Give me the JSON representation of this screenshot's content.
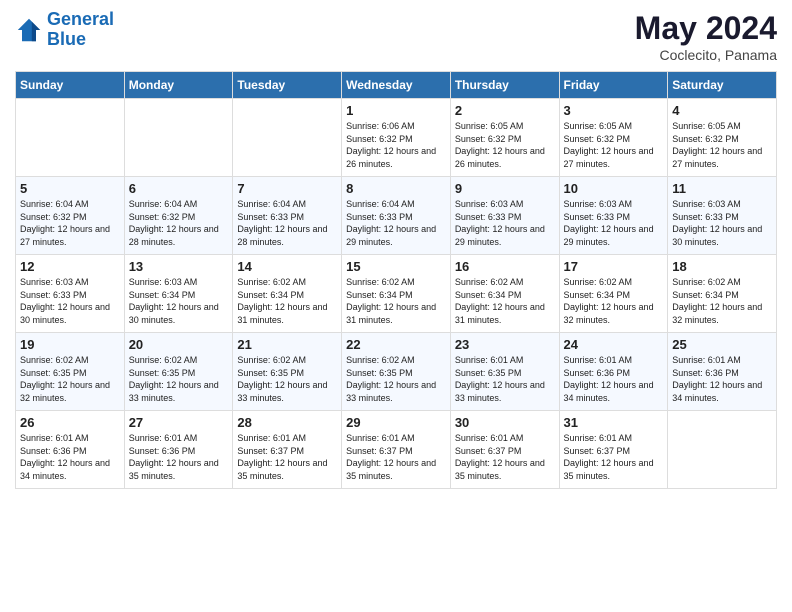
{
  "header": {
    "logo_line1": "General",
    "logo_line2": "Blue",
    "title": "May 2024",
    "subtitle": "Coclecito, Panama"
  },
  "days_of_week": [
    "Sunday",
    "Monday",
    "Tuesday",
    "Wednesday",
    "Thursday",
    "Friday",
    "Saturday"
  ],
  "weeks": [
    [
      {
        "day": "",
        "info": ""
      },
      {
        "day": "",
        "info": ""
      },
      {
        "day": "",
        "info": ""
      },
      {
        "day": "1",
        "info": "Sunrise: 6:06 AM\nSunset: 6:32 PM\nDaylight: 12 hours\nand 26 minutes."
      },
      {
        "day": "2",
        "info": "Sunrise: 6:05 AM\nSunset: 6:32 PM\nDaylight: 12 hours\nand 26 minutes."
      },
      {
        "day": "3",
        "info": "Sunrise: 6:05 AM\nSunset: 6:32 PM\nDaylight: 12 hours\nand 27 minutes."
      },
      {
        "day": "4",
        "info": "Sunrise: 6:05 AM\nSunset: 6:32 PM\nDaylight: 12 hours\nand 27 minutes."
      }
    ],
    [
      {
        "day": "5",
        "info": "Sunrise: 6:04 AM\nSunset: 6:32 PM\nDaylight: 12 hours\nand 27 minutes."
      },
      {
        "day": "6",
        "info": "Sunrise: 6:04 AM\nSunset: 6:32 PM\nDaylight: 12 hours\nand 28 minutes."
      },
      {
        "day": "7",
        "info": "Sunrise: 6:04 AM\nSunset: 6:33 PM\nDaylight: 12 hours\nand 28 minutes."
      },
      {
        "day": "8",
        "info": "Sunrise: 6:04 AM\nSunset: 6:33 PM\nDaylight: 12 hours\nand 29 minutes."
      },
      {
        "day": "9",
        "info": "Sunrise: 6:03 AM\nSunset: 6:33 PM\nDaylight: 12 hours\nand 29 minutes."
      },
      {
        "day": "10",
        "info": "Sunrise: 6:03 AM\nSunset: 6:33 PM\nDaylight: 12 hours\nand 29 minutes."
      },
      {
        "day": "11",
        "info": "Sunrise: 6:03 AM\nSunset: 6:33 PM\nDaylight: 12 hours\nand 30 minutes."
      }
    ],
    [
      {
        "day": "12",
        "info": "Sunrise: 6:03 AM\nSunset: 6:33 PM\nDaylight: 12 hours\nand 30 minutes."
      },
      {
        "day": "13",
        "info": "Sunrise: 6:03 AM\nSunset: 6:34 PM\nDaylight: 12 hours\nand 30 minutes."
      },
      {
        "day": "14",
        "info": "Sunrise: 6:02 AM\nSunset: 6:34 PM\nDaylight: 12 hours\nand 31 minutes."
      },
      {
        "day": "15",
        "info": "Sunrise: 6:02 AM\nSunset: 6:34 PM\nDaylight: 12 hours\nand 31 minutes."
      },
      {
        "day": "16",
        "info": "Sunrise: 6:02 AM\nSunset: 6:34 PM\nDaylight: 12 hours\nand 31 minutes."
      },
      {
        "day": "17",
        "info": "Sunrise: 6:02 AM\nSunset: 6:34 PM\nDaylight: 12 hours\nand 32 minutes."
      },
      {
        "day": "18",
        "info": "Sunrise: 6:02 AM\nSunset: 6:34 PM\nDaylight: 12 hours\nand 32 minutes."
      }
    ],
    [
      {
        "day": "19",
        "info": "Sunrise: 6:02 AM\nSunset: 6:35 PM\nDaylight: 12 hours\nand 32 minutes."
      },
      {
        "day": "20",
        "info": "Sunrise: 6:02 AM\nSunset: 6:35 PM\nDaylight: 12 hours\nand 33 minutes."
      },
      {
        "day": "21",
        "info": "Sunrise: 6:02 AM\nSunset: 6:35 PM\nDaylight: 12 hours\nand 33 minutes."
      },
      {
        "day": "22",
        "info": "Sunrise: 6:02 AM\nSunset: 6:35 PM\nDaylight: 12 hours\nand 33 minutes."
      },
      {
        "day": "23",
        "info": "Sunrise: 6:01 AM\nSunset: 6:35 PM\nDaylight: 12 hours\nand 33 minutes."
      },
      {
        "day": "24",
        "info": "Sunrise: 6:01 AM\nSunset: 6:36 PM\nDaylight: 12 hours\nand 34 minutes."
      },
      {
        "day": "25",
        "info": "Sunrise: 6:01 AM\nSunset: 6:36 PM\nDaylight: 12 hours\nand 34 minutes."
      }
    ],
    [
      {
        "day": "26",
        "info": "Sunrise: 6:01 AM\nSunset: 6:36 PM\nDaylight: 12 hours\nand 34 minutes."
      },
      {
        "day": "27",
        "info": "Sunrise: 6:01 AM\nSunset: 6:36 PM\nDaylight: 12 hours\nand 35 minutes."
      },
      {
        "day": "28",
        "info": "Sunrise: 6:01 AM\nSunset: 6:37 PM\nDaylight: 12 hours\nand 35 minutes."
      },
      {
        "day": "29",
        "info": "Sunrise: 6:01 AM\nSunset: 6:37 PM\nDaylight: 12 hours\nand 35 minutes."
      },
      {
        "day": "30",
        "info": "Sunrise: 6:01 AM\nSunset: 6:37 PM\nDaylight: 12 hours\nand 35 minutes."
      },
      {
        "day": "31",
        "info": "Sunrise: 6:01 AM\nSunset: 6:37 PM\nDaylight: 12 hours\nand 35 minutes."
      },
      {
        "day": "",
        "info": ""
      }
    ]
  ]
}
